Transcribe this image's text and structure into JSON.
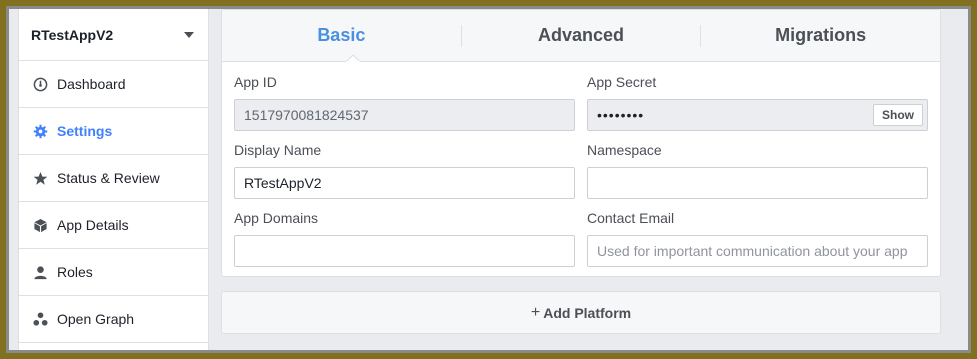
{
  "app": {
    "name": "RTestAppV2"
  },
  "sidebar": {
    "items": [
      {
        "label": "Dashboard",
        "icon": "dashboard-icon"
      },
      {
        "label": "Settings",
        "icon": "gear-icon",
        "active": true
      },
      {
        "label": "Status & Review",
        "icon": "star-icon"
      },
      {
        "label": "App Details",
        "icon": "cube-icon"
      },
      {
        "label": "Roles",
        "icon": "person-icon"
      },
      {
        "label": "Open Graph",
        "icon": "graph-icon"
      }
    ]
  },
  "tabs": [
    {
      "label": "Basic",
      "active": true
    },
    {
      "label": "Advanced"
    },
    {
      "label": "Migrations"
    }
  ],
  "form": {
    "app_id": {
      "label": "App ID",
      "value": "1517970081824537"
    },
    "app_secret": {
      "label": "App Secret",
      "value": "••••••••",
      "button": "Show"
    },
    "display_name": {
      "label": "Display Name",
      "value": "RTestAppV2"
    },
    "namespace": {
      "label": "Namespace",
      "value": ""
    },
    "app_domains": {
      "label": "App Domains",
      "value": ""
    },
    "contact_email": {
      "label": "Contact Email",
      "value": "",
      "placeholder": "Used for important communication about your app"
    }
  },
  "add_platform": {
    "label": "Add Platform",
    "icon": "plus-icon"
  },
  "colors": {
    "accent": "#4080ff",
    "tab_active": "#4a90e2",
    "background": "#e9ebee"
  }
}
